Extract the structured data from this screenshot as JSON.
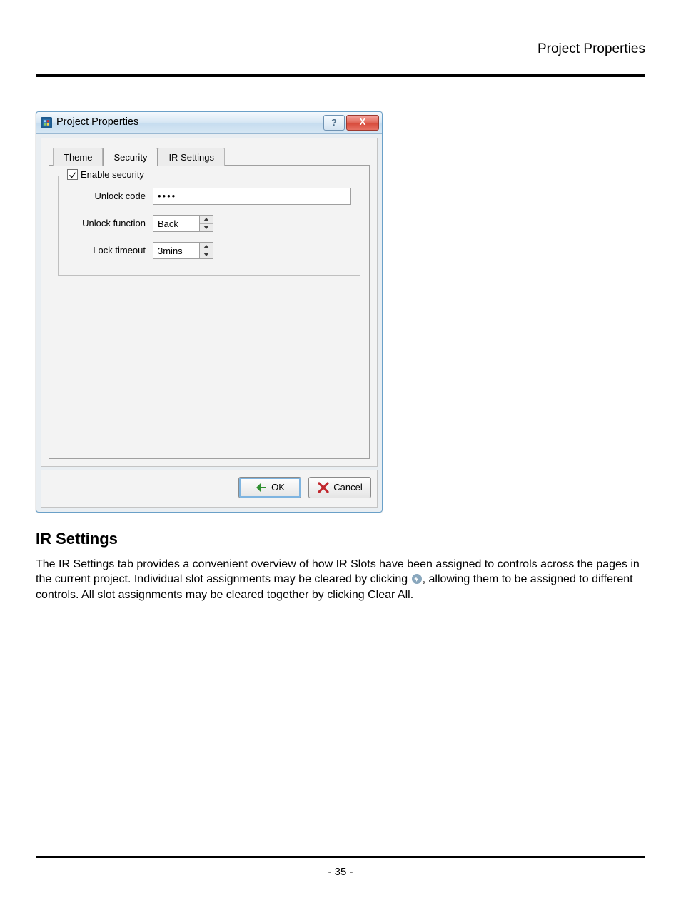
{
  "page": {
    "header_title": "Project Properties",
    "number_label": "- 35 -"
  },
  "dialog": {
    "title": "Project Properties",
    "titlebar": {
      "help_glyph": "?",
      "close_glyph": "X"
    },
    "tabs": {
      "theme": "Theme",
      "security": "Security",
      "ir": "IR Settings",
      "active_index": 1
    },
    "security": {
      "fieldset_label": "Enable security",
      "checked": true,
      "unlock_code_label": "Unlock code",
      "unlock_code_value": "••••",
      "unlock_function_label": "Unlock function",
      "unlock_function_value": "Back",
      "lock_timeout_label": "Lock timeout",
      "lock_timeout_value": "3mins"
    },
    "buttons": {
      "ok": "OK",
      "cancel": "Cancel"
    }
  },
  "section": {
    "heading": "IR Settings",
    "para1": "The IR Settings tab provides a convenient overview of how IR Slots have been assigned to controls across the pages in the current project. Individual slot assignments may be cleared by clicking ",
    "para2_after_icon": ", allowing them to be assigned to different controls. All slot assignments may be cleared together by clicking Clear All."
  }
}
